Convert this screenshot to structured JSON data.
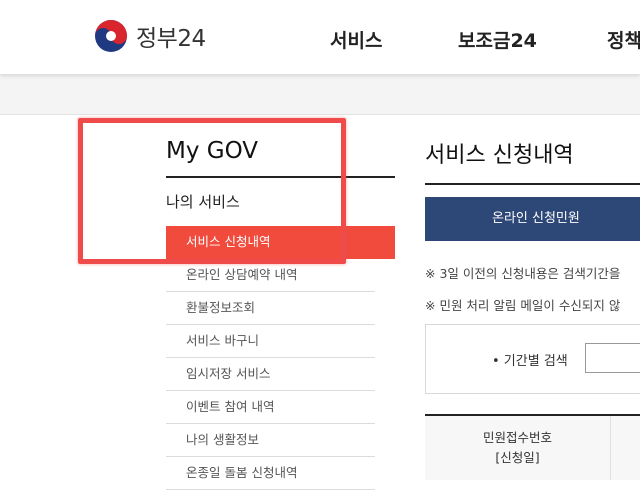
{
  "header": {
    "logo_text": "정부24",
    "nav": [
      "서비스",
      "보조금24",
      "정책"
    ]
  },
  "sidebar": {
    "title": "My GOV",
    "section": "나의 서비스",
    "items": [
      {
        "label": "서비스 신청내역",
        "active": true
      },
      {
        "label": "온라인 상담예약 내역",
        "active": false
      },
      {
        "label": "환불정보조회",
        "active": false
      },
      {
        "label": "서비스 바구니",
        "active": false
      },
      {
        "label": "임시저장 서비스",
        "active": false
      },
      {
        "label": "이벤트 참여 내역",
        "active": false
      },
      {
        "label": "나의 생활정보",
        "active": false
      },
      {
        "label": "온종일 돌봄 신청내역",
        "active": false
      }
    ]
  },
  "content": {
    "title": "서비스 신청내역",
    "tab_label": "온라인 신청민원",
    "notice1": "※ 3일 이전의 신청내용은 검색기간을",
    "notice2": "※ 민원 처리 알림 메일이 수신되지 않",
    "search_label": "• 기간별 검색",
    "table_header_line1": "민원접수번호",
    "table_header_line2": "[신청일]"
  },
  "colors": {
    "accent_red": "#f04b3d",
    "highlight_red": "#f04b4b",
    "navy": "#2d4777"
  }
}
